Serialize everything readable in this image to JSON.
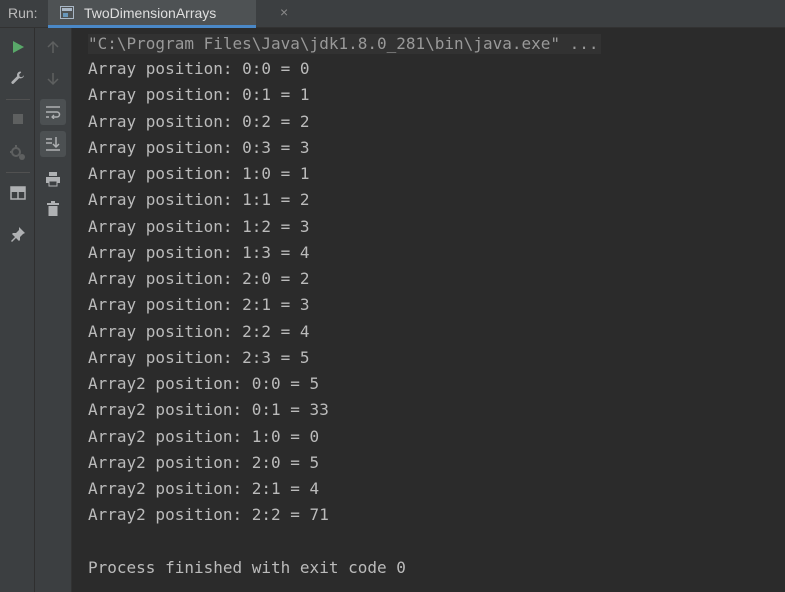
{
  "run_panel": {
    "label": "Run:",
    "tab_title": "TwoDimensionArrays",
    "close_glyph": "×"
  },
  "toolbar": {
    "left_icons": [
      "run-icon",
      "wrench-icon",
      "stop-icon",
      "debug-settings-icon",
      "layout-icon",
      "pin-icon"
    ],
    "right_icons": [
      "up-arrow-icon",
      "down-arrow-icon",
      "soft-wrap-icon",
      "scroll-to-end-icon",
      "print-icon",
      "trash-icon"
    ]
  },
  "console": {
    "command": "\"C:\\Program Files\\Java\\jdk1.8.0_281\\bin\\java.exe\" ...",
    "lines": [
      "Array position: 0:0 = 0",
      "Array position: 0:1 = 1",
      "Array position: 0:2 = 2",
      "Array position: 0:3 = 3",
      "Array position: 1:0 = 1",
      "Array position: 1:1 = 2",
      "Array position: 1:2 = 3",
      "Array position: 1:3 = 4",
      "Array position: 2:0 = 2",
      "Array position: 2:1 = 3",
      "Array position: 2:2 = 4",
      "Array position: 2:3 = 5",
      "Array2 position: 0:0 = 5",
      "Array2 position: 0:1 = 33",
      "Array2 position: 1:0 = 0",
      "Array2 position: 2:0 = 5",
      "Array2 position: 2:1 = 4",
      "Array2 position: 2:2 = 71"
    ],
    "exit_message": "Process finished with exit code 0"
  },
  "colors": {
    "background": "#2b2b2b",
    "panel": "#3c3f41",
    "text": "#bbbbbb",
    "run_green": "#59a869",
    "tab_underline": "#4a88c7"
  }
}
